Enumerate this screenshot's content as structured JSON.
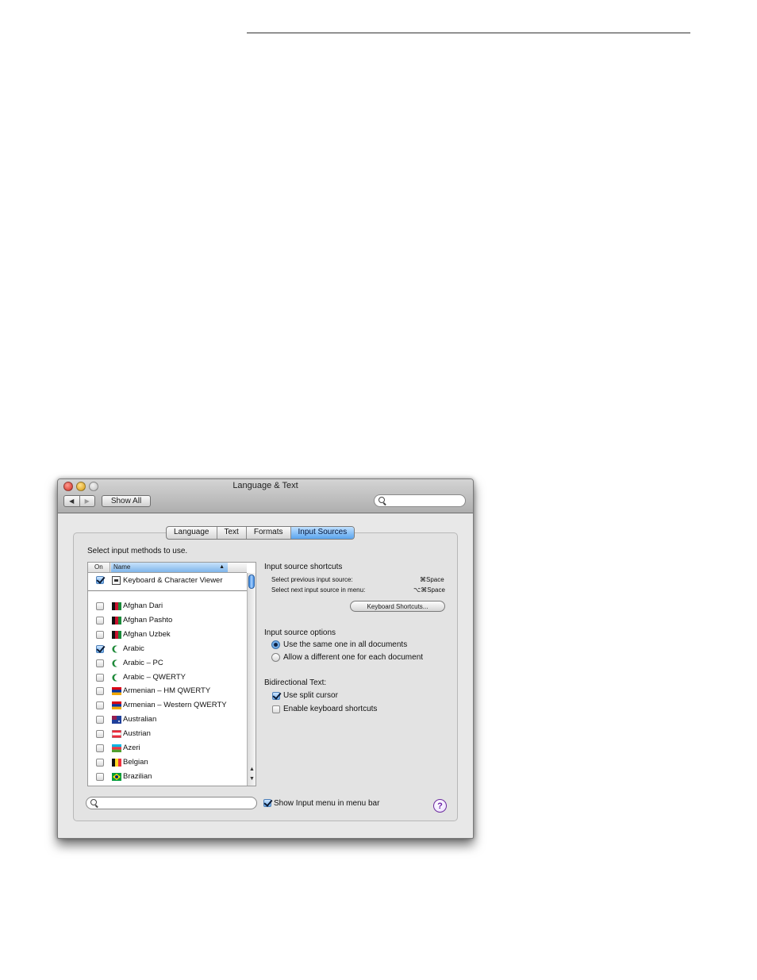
{
  "window": {
    "title": "Language & Text",
    "back_label": "◀",
    "forward_label": "▶",
    "show_all_label": "Show All",
    "search_placeholder": ""
  },
  "tabs": [
    {
      "label": "Language",
      "active": false
    },
    {
      "label": "Text",
      "active": false
    },
    {
      "label": "Formats",
      "active": false
    },
    {
      "label": "Input Sources",
      "active": true
    }
  ],
  "list": {
    "heading": "Select input methods to use.",
    "col_on": "On",
    "col_name": "Name",
    "sort_arrow": "▲",
    "keyboard_viewer": {
      "label": "Keyboard & Character Viewer",
      "checked": true
    },
    "items": [
      {
        "label": "Afghan Dari",
        "checked": false,
        "icon": "afghanistan-flag"
      },
      {
        "label": "Afghan Pashto",
        "checked": false,
        "icon": "afghanistan-flag"
      },
      {
        "label": "Afghan Uzbek",
        "checked": false,
        "icon": "afghanistan-flag"
      },
      {
        "label": "Arabic",
        "checked": true,
        "icon": "arabic-crescent"
      },
      {
        "label": "Arabic – PC",
        "checked": false,
        "icon": "arabic-crescent"
      },
      {
        "label": "Arabic – QWERTY",
        "checked": false,
        "icon": "arabic-crescent"
      },
      {
        "label": "Armenian – HM QWERTY",
        "checked": false,
        "icon": "armenia-flag"
      },
      {
        "label": "Armenian – Western QWERTY",
        "checked": false,
        "icon": "armenia-flag"
      },
      {
        "label": "Australian",
        "checked": false,
        "icon": "australia-flag"
      },
      {
        "label": "Austrian",
        "checked": false,
        "icon": "austria-flag"
      },
      {
        "label": "Azeri",
        "checked": false,
        "icon": "azerbaijan-flag"
      },
      {
        "label": "Belgian",
        "checked": false,
        "icon": "belgium-flag"
      },
      {
        "label": "Brazilian",
        "checked": false,
        "icon": "brazil-flag"
      }
    ]
  },
  "shortcuts": {
    "title": "Input source shortcuts",
    "prev_label": "Select previous input source:",
    "prev_key": "⌘Space",
    "next_label": "Select next input source in menu:",
    "next_key": "⌥⌘Space",
    "button_label": "Keyboard Shortcuts..."
  },
  "options": {
    "title": "Input source options",
    "same_label": "Use the same one in all documents",
    "different_label": "Allow a different one for each document",
    "selected": "same"
  },
  "bidi": {
    "title": "Bidirectional Text:",
    "split_cursor_label": "Use split cursor",
    "split_cursor_checked": true,
    "kb_shortcuts_label": "Enable keyboard shortcuts",
    "kb_shortcuts_checked": false
  },
  "footer": {
    "show_menu_label": "Show Input menu in menu bar",
    "show_menu_checked": true,
    "help_label": "?"
  }
}
